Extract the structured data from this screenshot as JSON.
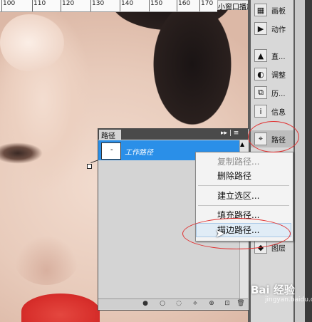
{
  "ruler": {
    "ticks": [
      "100",
      "110",
      "120",
      "130",
      "140",
      "150",
      "160",
      "170"
    ]
  },
  "mini_window": {
    "label": "小窗口播放"
  },
  "dock": {
    "items": [
      {
        "label": "画板",
        "icon": "artboard-icon"
      },
      {
        "label": "动作",
        "icon": "play-icon"
      },
      {
        "label": "直...",
        "icon": "histogram-icon"
      },
      {
        "label": "调整",
        "icon": "adjust-icon"
      },
      {
        "label": "历...",
        "icon": "history-icon"
      },
      {
        "label": "信息",
        "icon": "info-icon"
      },
      {
        "label": "路径",
        "icon": "paths-icon"
      },
      {
        "label": "图层",
        "icon": "layers-icon"
      }
    ]
  },
  "paths_panel": {
    "tab": "路径",
    "controls": "▸▸ | ≡",
    "path_name": "工作路径"
  },
  "context_menu": {
    "items": [
      {
        "label": "复制路径...",
        "enabled": false
      },
      {
        "label": "删除路径",
        "enabled": true
      },
      {
        "label": "建立选区...",
        "enabled": true
      },
      {
        "label": "填充路径...",
        "enabled": true
      },
      {
        "label": "描边路径...",
        "enabled": true,
        "hovered": true
      }
    ]
  },
  "footer_buttons": [
    "●",
    "○",
    "◌",
    "⟡",
    "⊕",
    "⊡",
    "🗑"
  ],
  "watermark": {
    "logo": "Bai 经验",
    "url": "jingyan.baidu.com"
  },
  "colors": {
    "selection": "#2a8fe8",
    "annotation": "#e03030"
  }
}
